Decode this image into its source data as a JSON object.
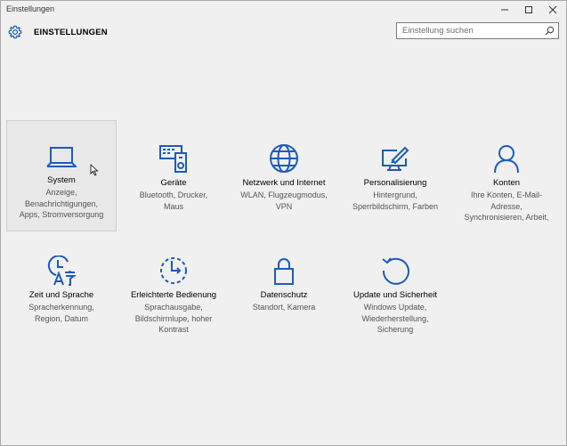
{
  "window": {
    "title": "Einstellungen"
  },
  "header": {
    "title": "EINSTELLUNGEN"
  },
  "search": {
    "placeholder": "Einstellung suchen"
  },
  "accent_color": "#1e5bbf",
  "tiles": [
    {
      "name": "System",
      "icon": "laptop-icon",
      "desc": [
        "Anzeige,",
        "Benachrichtigungen,",
        "Apps, Stromversorgung"
      ]
    },
    {
      "name": "Geräte",
      "icon": "devices-icon",
      "desc": [
        "Bluetooth, Drucker,",
        "Maus"
      ]
    },
    {
      "name": "Netzwerk und Internet",
      "icon": "globe-icon",
      "desc": [
        "WLAN, Flugzeugmodus,",
        "VPN"
      ]
    },
    {
      "name": "Personalisierung",
      "icon": "personalization-icon",
      "desc": [
        "Hintergrund,",
        "Sperrbildschirm, Farben"
      ]
    },
    {
      "name": "Konten",
      "icon": "person-icon",
      "desc": [
        "Ihre Konten, E-Mail-",
        "Adresse,",
        "Synchronisieren, Arbeit,"
      ]
    },
    {
      "name": "Zeit und Sprache",
      "icon": "time-language-icon",
      "desc": [
        "Spracherkennung,",
        "Region, Datum"
      ]
    },
    {
      "name": "Erleichterte Bedienung",
      "icon": "ease-of-access-icon",
      "desc": [
        "Sprachausgabe,",
        "Bildschirmlupe, hoher",
        "Kontrast"
      ]
    },
    {
      "name": "Datenschutz",
      "icon": "lock-icon",
      "desc": [
        "Standort, Kamera"
      ]
    },
    {
      "name": "Update und Sicherheit",
      "icon": "update-icon",
      "desc": [
        "Windows Update,",
        "Wiederherstellung,",
        "Sicherung"
      ]
    }
  ]
}
